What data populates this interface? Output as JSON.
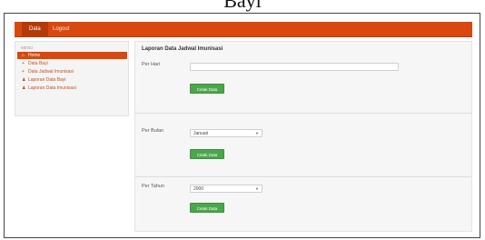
{
  "caption": "Bayi",
  "navbar": {
    "items": [
      "Data",
      "Logout"
    ]
  },
  "sidebar": {
    "heading": "MENU",
    "items": [
      {
        "label": "Home",
        "icon": "home-icon"
      },
      {
        "label": "Data Bayi",
        "icon": "plus-icon"
      },
      {
        "label": "Data Jadwal Imunisasi",
        "icon": "plus-icon"
      },
      {
        "label": "Laporan Data Bayi",
        "icon": "user-icon"
      },
      {
        "label": "Laporan Data Imunisasi",
        "icon": "user-icon"
      }
    ]
  },
  "main": {
    "title": "Laporan Data Jadwal Imunisasi",
    "sections": [
      {
        "label": "Per Hari",
        "value": "",
        "button": "Cetak Data"
      },
      {
        "label": "Per Bulan",
        "value": "Januari",
        "button": "Cetak Data"
      },
      {
        "label": "Per Tahun",
        "value": "2000",
        "button": "Cetak Data"
      }
    ]
  },
  "colors": {
    "accent": "#d9480f",
    "button": "#4ca64c"
  }
}
